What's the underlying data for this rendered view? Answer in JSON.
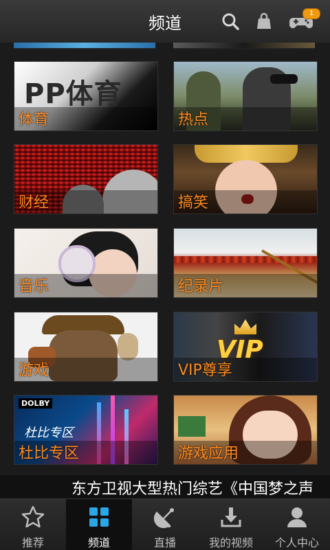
{
  "header": {
    "title": "频道",
    "notification_count": "1",
    "icons": [
      "search-icon",
      "shopping-bag-icon",
      "gamepad-icon"
    ]
  },
  "channels": [
    {
      "label": "体育",
      "thumb_text": "PP体育"
    },
    {
      "label": "热点"
    },
    {
      "label": "财经"
    },
    {
      "label": "搞笑"
    },
    {
      "label": "音乐"
    },
    {
      "label": "纪录片"
    },
    {
      "label": "游戏"
    },
    {
      "label": "VIP尊享",
      "thumb_text": "VIP"
    },
    {
      "label": "杜比专区",
      "thumb_text": "DOLBY",
      "thumb_subtext": "杜比专区"
    },
    {
      "label": "游戏应用"
    }
  ],
  "marquee": {
    "text": "东方卫视大型热门综艺《中国梦之声"
  },
  "bottom_nav": [
    {
      "label": "推荐",
      "icon": "star-icon"
    },
    {
      "label": "频道",
      "icon": "grid-icon",
      "active": true
    },
    {
      "label": "直播",
      "icon": "satellite-dish-icon"
    },
    {
      "label": "我的视频",
      "icon": "download-icon"
    },
    {
      "label": "个人中心",
      "icon": "user-icon"
    }
  ],
  "colors": {
    "accent": "#ff8a1f",
    "nav_active": "#2aa7e6",
    "badge": "#f09a12"
  }
}
